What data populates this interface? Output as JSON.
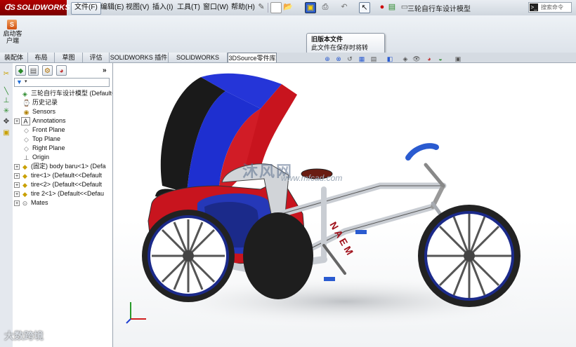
{
  "app": {
    "brand": "SOLIDWORKS",
    "document_title": "三轮自行车设计模型"
  },
  "menu": [
    "文件(F)",
    "编辑(E)",
    "视图(V)",
    "插入(I)",
    "工具(T)",
    "窗口(W)",
    "帮助(H)"
  ],
  "search": {
    "label": "搜索命令"
  },
  "command_manager": {
    "launch_label": "启动客户端"
  },
  "tooltip": {
    "title": "旧版本文件",
    "body": "此文件在保存时将转换。"
  },
  "tabs": [
    "装配体",
    "布局",
    "草图",
    "评估",
    "SOLIDWORKS 插件",
    "SOLIDWORKS MBD",
    "3DSource零件库"
  ],
  "feature_tree": {
    "root": "三轮自行车设计模型  (Default<D",
    "items": [
      {
        "label": "历史记录",
        "icon": "history-icon"
      },
      {
        "label": "Sensors",
        "icon": "sensor-icon"
      },
      {
        "label": "Annotations",
        "icon": "annotation-icon"
      },
      {
        "label": "Front Plane",
        "icon": "plane-icon"
      },
      {
        "label": "Top Plane",
        "icon": "plane-icon"
      },
      {
        "label": "Right Plane",
        "icon": "plane-icon"
      },
      {
        "label": "Origin",
        "icon": "origin-icon"
      },
      {
        "label": "(固定) body baru<1> (Defa",
        "icon": "part-icon"
      },
      {
        "label": "tire<1> (Default<<Default",
        "icon": "part-icon"
      },
      {
        "label": "tire<2> (Default<<Default",
        "icon": "part-icon"
      },
      {
        "label": "tire 2<1> (Default<<Defau",
        "icon": "part-icon"
      },
      {
        "label": "Mates",
        "icon": "mates-icon"
      }
    ]
  },
  "watermark": {
    "cn": "沐风网",
    "en": "www.mfcad.com",
    "corner": "大数跨境"
  },
  "colors": {
    "brand_red": "#a00000",
    "canopy_blue": "#1e2fd0",
    "canopy_red": "#c8141e",
    "frame_gray": "#c9cdd3"
  }
}
